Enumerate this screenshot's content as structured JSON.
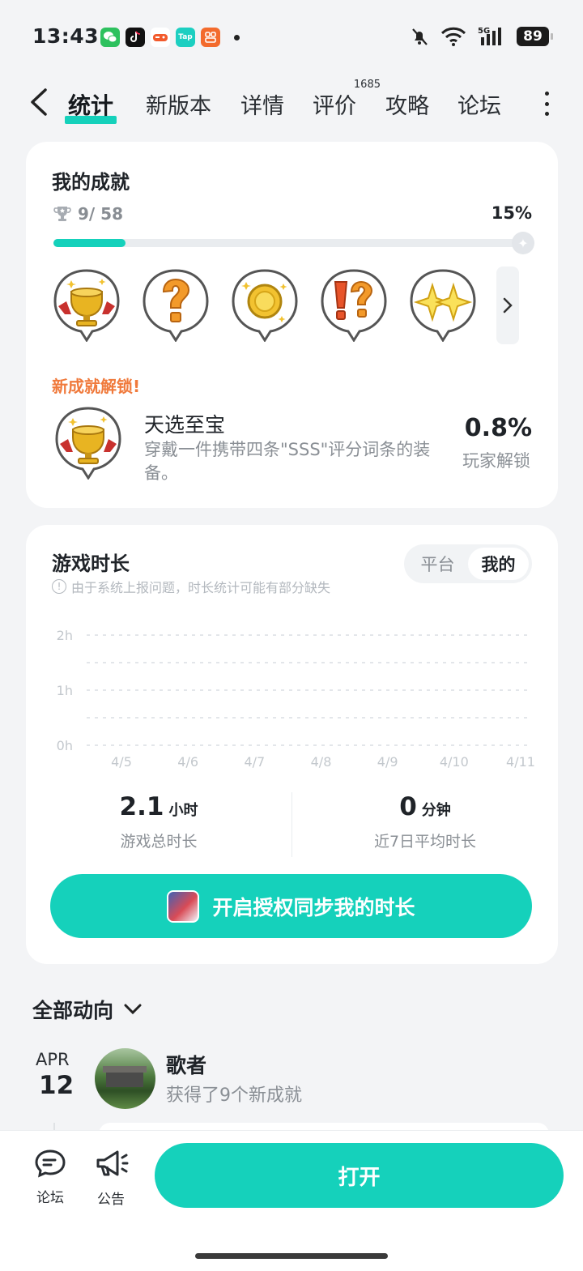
{
  "status_bar": {
    "time": "13:43",
    "battery": "89",
    "network": "5G",
    "notification_apps": [
      "wechat-icon",
      "tiktok-icon",
      "game-icon",
      "taptap-icon",
      "app-icon"
    ],
    "right_icons": [
      "mute-bell-icon",
      "wifi-icon",
      "signal-icon"
    ]
  },
  "nav": {
    "tabs": [
      {
        "label": "统计",
        "active": true
      },
      {
        "label": "新版本"
      },
      {
        "label": "详情"
      },
      {
        "label": "评价",
        "badge": "1685"
      },
      {
        "label": "攻略"
      },
      {
        "label": "论坛"
      }
    ]
  },
  "achievements": {
    "title": "我的成就",
    "count": "9/ 58",
    "percent_text": "15%",
    "progress": 0.15,
    "badges": [
      "golden-trophy-badge",
      "question-mark-badge",
      "gold-coin-badge",
      "exclamation-question-badge",
      "sparkle-stars-badge"
    ],
    "new_unlock_label": "新成就解锁!",
    "latest": {
      "name": "天选至宝",
      "description": "穿戴一件携带四条\"SSS\"评分词条的装备。",
      "rate": "0.8%",
      "rate_label": "玩家解锁"
    }
  },
  "playtime": {
    "title": "游戏时长",
    "notice": "由于系统上报问题，时长统计可能有部分缺失",
    "segments": [
      {
        "label": "平台"
      },
      {
        "label": "我的",
        "active": true
      }
    ],
    "total_value": "2.1",
    "total_unit": "小时",
    "total_label": "游戏总时长",
    "avg_value": "0",
    "avg_unit": "分钟",
    "avg_label": "近7日平均时长",
    "auth_button": "开启授权同步我的时长"
  },
  "chart_data": {
    "type": "bar",
    "categories": [
      "4/5",
      "4/6",
      "4/7",
      "4/8",
      "4/9",
      "4/10",
      "4/11"
    ],
    "values": [
      0,
      0,
      0,
      0,
      0,
      0,
      0
    ],
    "y_ticks": [
      "0h",
      "1h",
      "2h"
    ],
    "ylim": [
      0,
      2
    ],
    "grid": true
  },
  "feed": {
    "title": "全部动向",
    "items": [
      {
        "month": "APR",
        "day": "12",
        "name": "歌者",
        "text": "获得了9个新成就"
      }
    ]
  },
  "bottom": {
    "forum_label": "论坛",
    "notice_label": "公告",
    "open_button": "打开"
  },
  "colors": {
    "accent": "#15d1bb",
    "highlight": "#f07a3c"
  }
}
